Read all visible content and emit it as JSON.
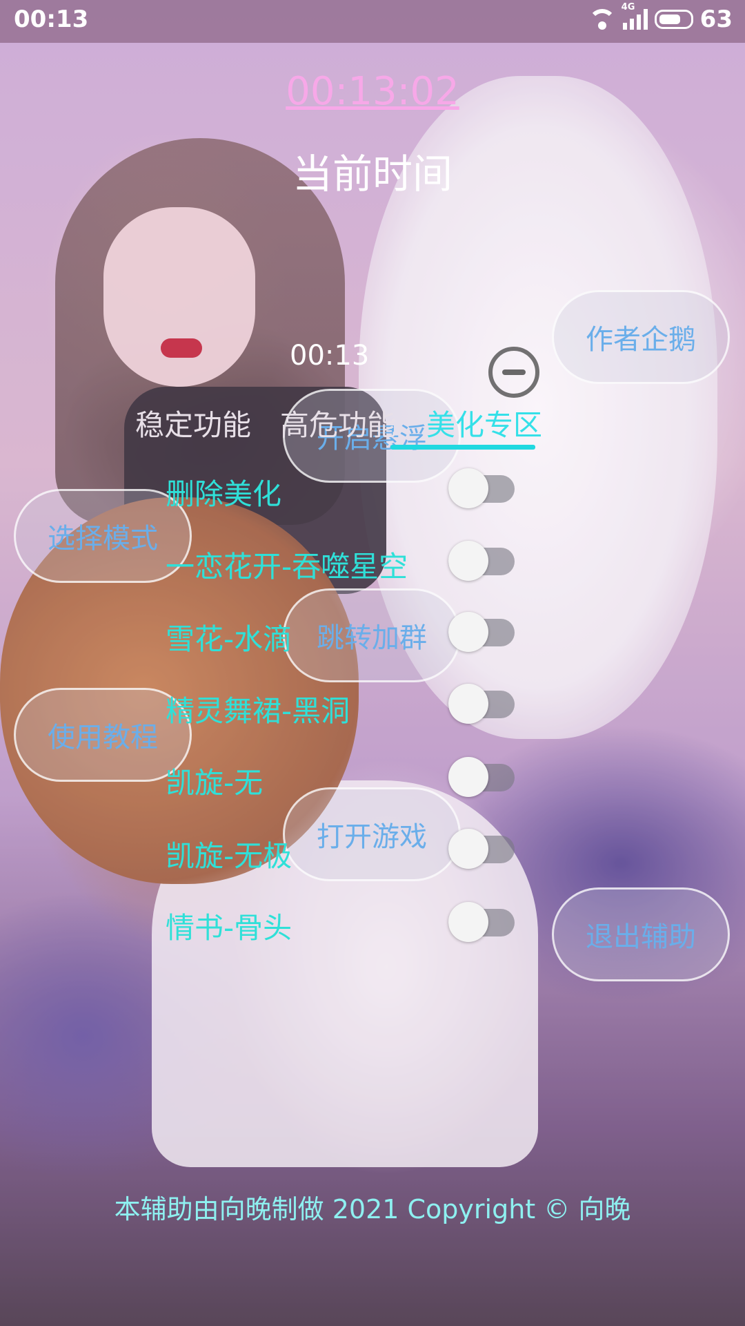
{
  "status_bar": {
    "time": "00:13",
    "network": "4G",
    "battery": "63"
  },
  "clock": {
    "time": "00:13:02",
    "label": "当前时间"
  },
  "floating_time": "00:13",
  "tabs": [
    {
      "label": "稳定功能"
    },
    {
      "label": "高危功能"
    },
    {
      "label": "美化专区",
      "active": true
    }
  ],
  "buttons": {
    "author": "作者企鹅",
    "float": "开启悬浮",
    "mode": "选择模式",
    "group": "跳转加群",
    "tutorial": "使用教程",
    "game": "打开游戏",
    "exit": "退出辅助"
  },
  "features": [
    {
      "label": "删除美化",
      "on": false
    },
    {
      "label": "一恋花开-吞噬星空",
      "on": false
    },
    {
      "label": "雪花-水滴",
      "on": false
    },
    {
      "label": "精灵舞裙-黑洞",
      "on": false
    },
    {
      "label": "凯旋-无",
      "on": false
    },
    {
      "label": "凯旋-无极",
      "on": false
    },
    {
      "label": "情书-骨头",
      "on": false
    }
  ],
  "footer": "本辅助由向晚制做 2021 Copyright © 向晚",
  "colors": {
    "accent": "#2fe0d8",
    "clock": "#f7a8e8",
    "button_text": "#6aaeea"
  }
}
